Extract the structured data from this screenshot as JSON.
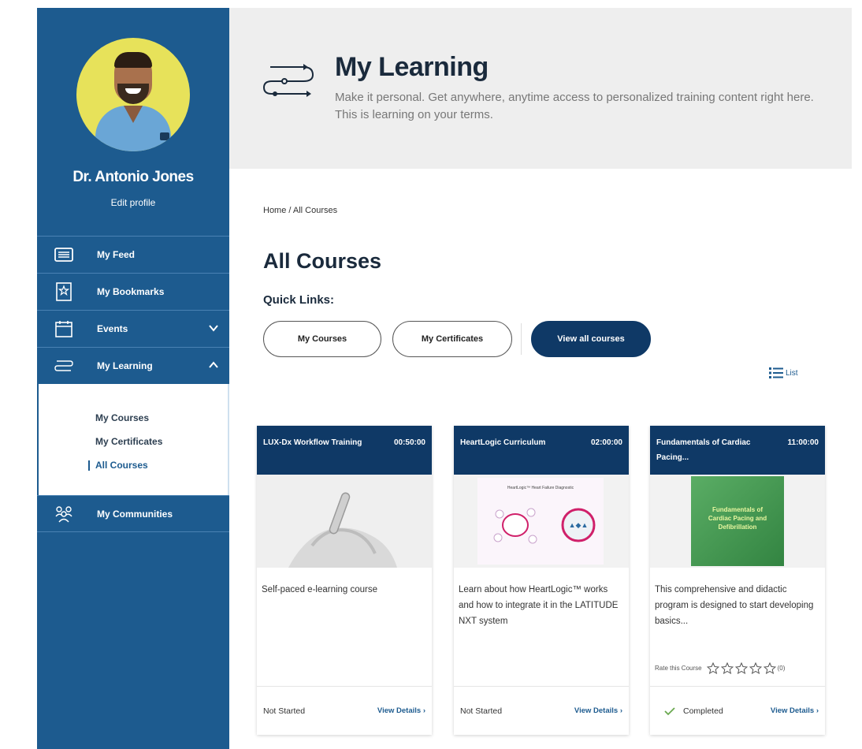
{
  "profile": {
    "name": "Dr. Antonio Jones",
    "edit_label": "Edit profile"
  },
  "nav": {
    "items": [
      {
        "label": "My Feed",
        "icon": "feed-icon"
      },
      {
        "label": "My Bookmarks",
        "icon": "bookmark-icon"
      },
      {
        "label": "Events",
        "icon": "calendar-icon",
        "chevron": "down"
      },
      {
        "label": "My Learning",
        "icon": "learning-path-icon",
        "chevron": "up"
      }
    ],
    "sub_items": [
      {
        "label": "My Courses",
        "active": false
      },
      {
        "label": "My Certificates",
        "active": false
      },
      {
        "label": "All Courses",
        "active": true
      }
    ],
    "communities": {
      "label": "My Communities",
      "icon": "communities-icon"
    }
  },
  "hero": {
    "title": "My Learning",
    "description": "Make it personal. Get anywhere, anytime access to personalized training content right here. This is learning on your terms."
  },
  "breadcrumb": "Home / All Courses",
  "page_title": "All Courses",
  "quick_links": {
    "title": "Quick Links:",
    "buttons": [
      "My Courses",
      "My Certificates",
      "View all courses"
    ]
  },
  "view_toggle": {
    "label": "List"
  },
  "cards": [
    {
      "title": "LUX-Dx Workflow Training",
      "duration": "00:50:00",
      "description": "Self-paced e-learning course",
      "status": "Not Started",
      "details_label": "View Details ›"
    },
    {
      "title": "HeartLogic Curriculum",
      "duration": "02:00:00",
      "image_caption": "HeartLogic™ Heart Failure Diagnostic",
      "description": "Learn about how HeartLogic™ works and how to integrate it in the LATITUDE NXT system",
      "status": "Not Started",
      "details_label": "View Details ›"
    },
    {
      "title": "Fundamentals of Cardiac Pacing...",
      "duration": "11:00:00",
      "image_caption": "Fundamentals of Cardiac Pacing and Defibrillation",
      "description": "This comprehensive and didactic program is designed to start developing basics...",
      "rate_label": "Rate this Course",
      "rating_count": "(0)",
      "rating_max": 5,
      "status": "Completed",
      "details_label": "View Details ›"
    }
  ],
  "colors": {
    "sidebar": "#1d5b8f",
    "primary": "#0f3966",
    "hero_bg": "#eeeeee",
    "avatar_bg": "#e7e25a",
    "book_cover": "#3e9a4e"
  }
}
